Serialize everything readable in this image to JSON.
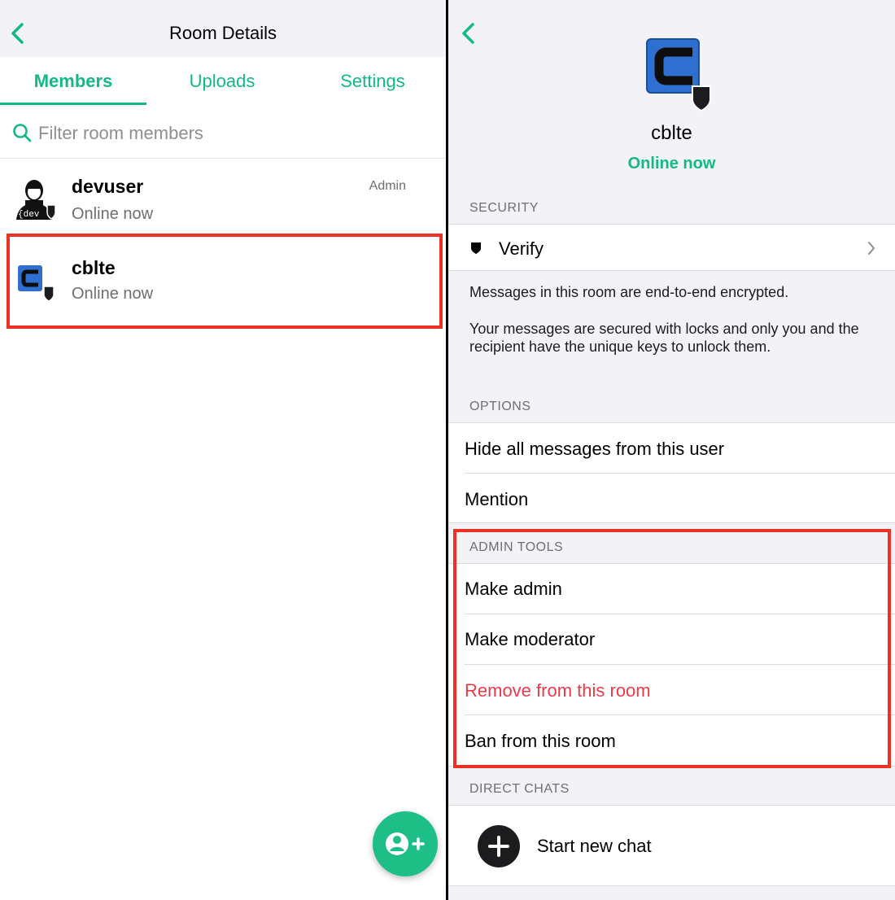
{
  "left": {
    "nav": {
      "title": "Room Details"
    },
    "tabs": [
      {
        "label": "Members",
        "active": true
      },
      {
        "label": "Uploads",
        "active": false
      },
      {
        "label": "Settings",
        "active": false
      }
    ],
    "search": {
      "placeholder": "Filter room members"
    },
    "members": [
      {
        "name": "devuser",
        "status": "Online now",
        "role": "Admin",
        "avatar": "dev-avatar"
      },
      {
        "name": "cblte",
        "status": "Online now",
        "role": "",
        "avatar": "cb-logo"
      }
    ],
    "fab": {
      "icon": "add-user-icon"
    }
  },
  "right": {
    "profile": {
      "name": "cblte",
      "status": "Online now"
    },
    "security": {
      "header": "SECURITY",
      "verify_label": "Verify",
      "info_line1": "Messages in this room are end-to-end encrypted.",
      "info_line2": "Your messages are secured with locks and only you and the recipient have the unique keys to unlock them."
    },
    "options": {
      "header": "OPTIONS",
      "items": [
        "Hide all messages from this user",
        "Mention"
      ]
    },
    "admin_tools": {
      "header": "ADMIN TOOLS",
      "items": [
        "Make admin",
        "Make moderator",
        "Remove from this room",
        "Ban from this room"
      ]
    },
    "direct_chats": {
      "header": "DIRECT CHATS",
      "start_label": "Start new chat"
    }
  },
  "colors": {
    "accent": "#12b886",
    "danger": "#ea3b4a",
    "highlight": "#ea3323",
    "fab": "#1dbf86"
  }
}
